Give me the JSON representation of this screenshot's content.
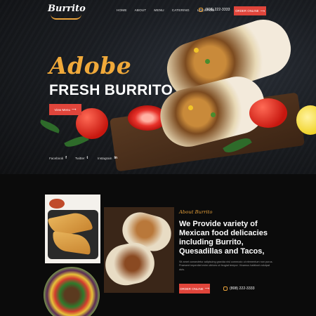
{
  "header": {
    "logo_text": "Burrito",
    "nav": [
      "HOME",
      "ABOUT",
      "MENU",
      "CATERING",
      "LOCATION"
    ],
    "phone": "(808) 222-3333",
    "order_label": "ORDER ONLINE"
  },
  "hero": {
    "script_title": "Adobe",
    "title": "FRESH BURRITO",
    "cta_label": "View Menu"
  },
  "social": [
    {
      "label": "Facebook",
      "icon": "f"
    },
    {
      "label": "Twitter",
      "icon": "t"
    },
    {
      "label": "Instagram",
      "icon": "in"
    }
  ],
  "about": {
    "tag": "About Burrito",
    "heading": "We Provide variety of Mexican food delicacies including Burrito, Quesadillas and Tacos,",
    "body": "Sit amet consectetur adipiscing gravida nisl commodo ut elementum non purus. Praesent imperdiet enim ultrices ut feugiat tempor. Vivamus habitant volutpat duis.",
    "order_label": "ORDER ONLINE",
    "phone": "(808) 222-3333"
  },
  "colors": {
    "accent": "#e0453b",
    "gold": "#e9a23b",
    "background": "#0c0c0c"
  }
}
